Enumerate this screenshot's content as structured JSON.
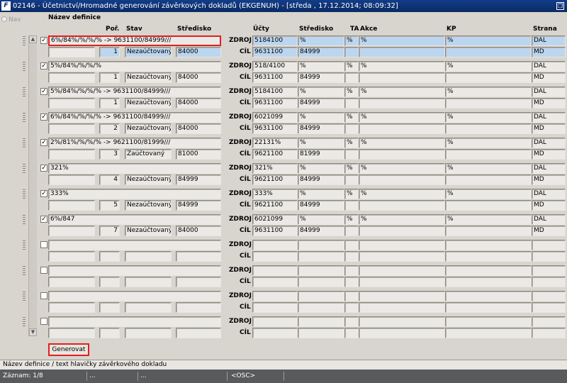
{
  "window": {
    "title": "02146 - Účetnictví/Hromadné generování závěrkových dokladů (EKGENUH) - [středa , 17.12.2014; 08:09:32]",
    "app_icon": "F"
  },
  "nav_label": "Nav",
  "headers": {
    "nazev": "Název definice",
    "por": "Poř.",
    "stav": "Stav",
    "stredisko": "Středisko",
    "ucty": "Účty",
    "stredisko2": "Středisko",
    "ta": "TA",
    "akce": "Akce",
    "kp": "KP",
    "strana": "Strana"
  },
  "labels": {
    "zdroj": "ZDROJ",
    "cil": "CÍL"
  },
  "rows": [
    {
      "checked": true,
      "name": "6%/84%/%/%/% -> 9631100/84999///",
      "por": "1",
      "stav": "Nezaúčtovaný",
      "stredisko": "84000",
      "zdroj": {
        "ucty": "5184100",
        "str": "%",
        "ta": "%",
        "akce": "%",
        "kp": "%",
        "strana": "DAL"
      },
      "cil": {
        "ucty": "9631100",
        "str": "84999",
        "ta": "",
        "akce": "",
        "kp": "",
        "strana": "MD"
      }
    },
    {
      "checked": true,
      "name": "5%/84%/%/%/%",
      "por": "1",
      "stav": "Nezaúčtovaný",
      "stredisko": "84000",
      "zdroj": {
        "ucty": "518/4100",
        "str": "%",
        "ta": "%",
        "akce": "%",
        "kp": "%",
        "strana": "DAL"
      },
      "cil": {
        "ucty": "9631100",
        "str": "84999",
        "ta": "",
        "akce": "",
        "kp": "",
        "strana": "MD"
      }
    },
    {
      "checked": true,
      "name": "5%/84%/%/%/% -> 9631100/84999///",
      "por": "1",
      "stav": "Nezaúčtovaný",
      "stredisko": "84000",
      "zdroj": {
        "ucty": "5184100",
        "str": "%",
        "ta": "%",
        "akce": "%",
        "kp": "%",
        "strana": "DAL"
      },
      "cil": {
        "ucty": "9631100",
        "str": "84999",
        "ta": "",
        "akce": "",
        "kp": "",
        "strana": "MD"
      }
    },
    {
      "checked": true,
      "name": "6%/84%/%/%/% -> 9631100/84999///",
      "por": "2",
      "stav": "Nezaúčtovaný",
      "stredisko": "84000",
      "zdroj": {
        "ucty": "6021099",
        "str": "%",
        "ta": "%",
        "akce": "%",
        "kp": "%",
        "strana": "DAL"
      },
      "cil": {
        "ucty": "9631100",
        "str": "84999",
        "ta": "",
        "akce": "",
        "kp": "",
        "strana": "MD"
      }
    },
    {
      "checked": true,
      "name": "2%/81%/%/%/% -> 9621100/81999///",
      "por": "3",
      "stav": "Zaúčtovaný",
      "stredisko": "81000",
      "zdroj": {
        "ucty": "22131%",
        "str": "%",
        "ta": "%",
        "akce": "%",
        "kp": "%",
        "strana": "DAL"
      },
      "cil": {
        "ucty": "9621100",
        "str": "81999",
        "ta": "",
        "akce": "",
        "kp": "",
        "strana": "MD"
      }
    },
    {
      "checked": true,
      "name": "321%",
      "por": "4",
      "stav": "Nezaúčtovaný",
      "stredisko": "84999",
      "zdroj": {
        "ucty": "321%",
        "str": "%",
        "ta": "%",
        "akce": "%",
        "kp": "%",
        "strana": "DAL"
      },
      "cil": {
        "ucty": "9621100",
        "str": "84999",
        "ta": "",
        "akce": "",
        "kp": "",
        "strana": "MD"
      }
    },
    {
      "checked": true,
      "name": "333%",
      "por": "5",
      "stav": "Nezaúčtovaný",
      "stredisko": "84999",
      "zdroj": {
        "ucty": "333%",
        "str": "%",
        "ta": "%",
        "akce": "%",
        "kp": "%",
        "strana": "DAL"
      },
      "cil": {
        "ucty": "9621100",
        "str": "84999",
        "ta": "",
        "akce": "",
        "kp": "",
        "strana": "MD"
      }
    },
    {
      "checked": true,
      "name": "6%/847",
      "por": "7",
      "stav": "Nezaúčtovaný",
      "stredisko": "84000",
      "zdroj": {
        "ucty": "6021099",
        "str": "%",
        "ta": "%",
        "akce": "%",
        "kp": "%",
        "strana": "DAL"
      },
      "cil": {
        "ucty": "9631100",
        "str": "84999",
        "ta": "",
        "akce": "",
        "kp": "",
        "strana": "MD"
      }
    },
    {
      "checked": false,
      "name": "",
      "por": "",
      "stav": "",
      "stredisko": "",
      "zdroj": {
        "ucty": "",
        "str": "",
        "ta": "",
        "akce": "",
        "kp": "",
        "strana": ""
      },
      "cil": {
        "ucty": "",
        "str": "",
        "ta": "",
        "akce": "",
        "kp": "",
        "strana": ""
      }
    },
    {
      "checked": false,
      "name": "",
      "por": "",
      "stav": "",
      "stredisko": "",
      "zdroj": {
        "ucty": "",
        "str": "",
        "ta": "",
        "akce": "",
        "kp": "",
        "strana": ""
      },
      "cil": {
        "ucty": "",
        "str": "",
        "ta": "",
        "akce": "",
        "kp": "",
        "strana": ""
      }
    },
    {
      "checked": false,
      "name": "",
      "por": "",
      "stav": "",
      "stredisko": "",
      "zdroj": {
        "ucty": "",
        "str": "",
        "ta": "",
        "akce": "",
        "kp": "",
        "strana": ""
      },
      "cil": {
        "ucty": "",
        "str": "",
        "ta": "",
        "akce": "",
        "kp": "",
        "strana": ""
      }
    },
    {
      "checked": false,
      "name": "",
      "por": "",
      "stav": "",
      "stredisko": "",
      "zdroj": {
        "ucty": "",
        "str": "",
        "ta": "",
        "akce": "",
        "kp": "",
        "strana": ""
      },
      "cil": {
        "ucty": "",
        "str": "",
        "ta": "",
        "akce": "",
        "kp": "",
        "strana": ""
      }
    }
  ],
  "generate_button": "Generovat",
  "status": {
    "hint": "Název definice / text hlavičky závěrkového dokladu",
    "record": "Záznam: 1/8",
    "dots1": "...",
    "dots2": "...",
    "osc": "<OSC>"
  },
  "colors": {
    "title_bar": "#0a2a63",
    "selected": "#bcd6f0",
    "focus_border": "#e02020"
  }
}
